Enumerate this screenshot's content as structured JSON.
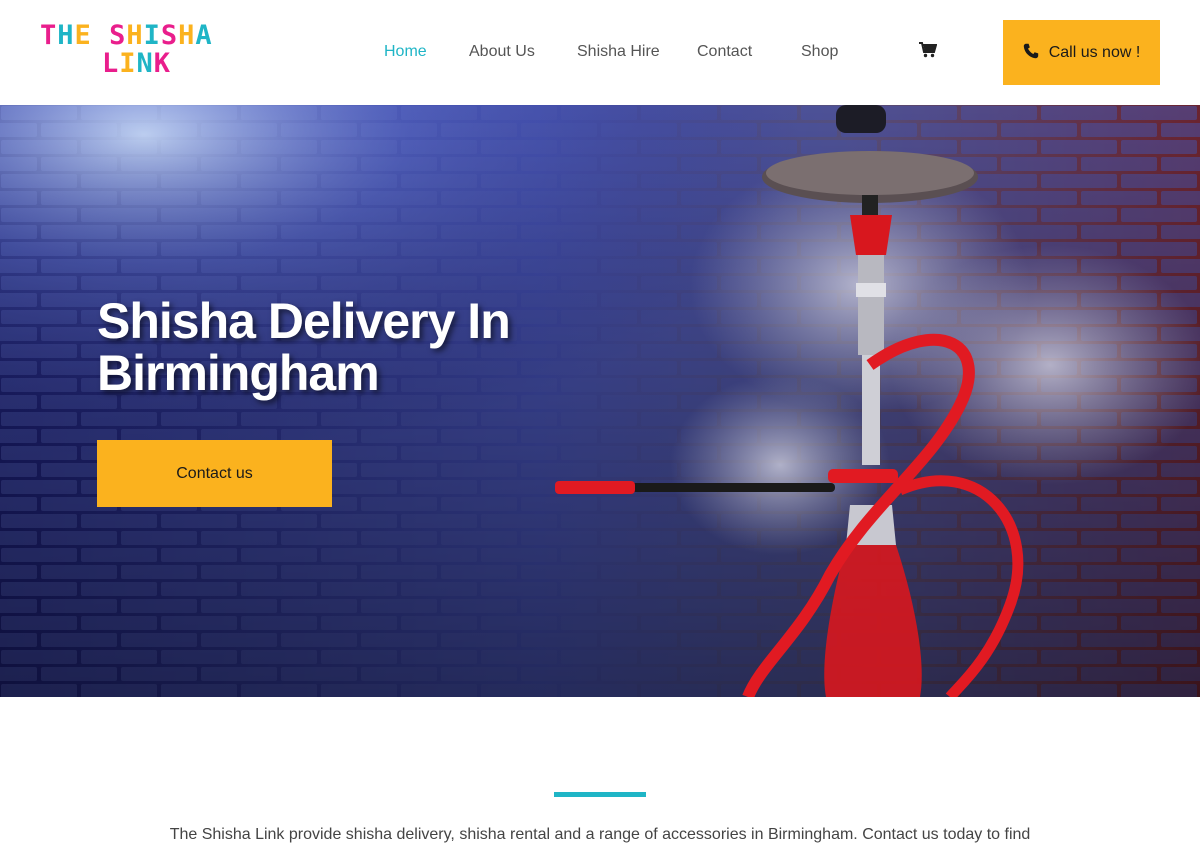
{
  "header": {
    "logo": {
      "line1": [
        "T",
        "H",
        "E",
        " ",
        "S",
        "H",
        "I",
        "S",
        "H",
        "A"
      ],
      "line2": [
        "L",
        "I",
        "N",
        "K"
      ],
      "colors": [
        "#e91e8c",
        "#1fb5c6",
        "#fbb21e",
        "#1fb5c6",
        "#e91e8c",
        "#fbb21e",
        "#1fb5c6",
        "#e91e8c",
        "#fbb21e",
        "#1fb5c6"
      ]
    },
    "nav": [
      {
        "label": "Home",
        "active": true
      },
      {
        "label": "About Us",
        "active": false
      },
      {
        "label": "Shisha Hire",
        "active": false
      },
      {
        "label": "Contact",
        "active": false
      },
      {
        "label": "Shop",
        "active": false
      }
    ],
    "cart_icon": "shopping-cart-icon",
    "call_button": {
      "label": "Call us now !",
      "icon": "phone-icon"
    }
  },
  "hero": {
    "title": "Shisha Delivery In Birmingham",
    "button_label": "Contact us"
  },
  "intro": {
    "text": "The Shisha Link provide shisha delivery, shisha rental and a range of accessories in Birmingham. Contact us today to find"
  },
  "colors": {
    "accent": "#1fb5c6",
    "button": "#fbb21e",
    "logo_pink": "#e91e8c"
  }
}
